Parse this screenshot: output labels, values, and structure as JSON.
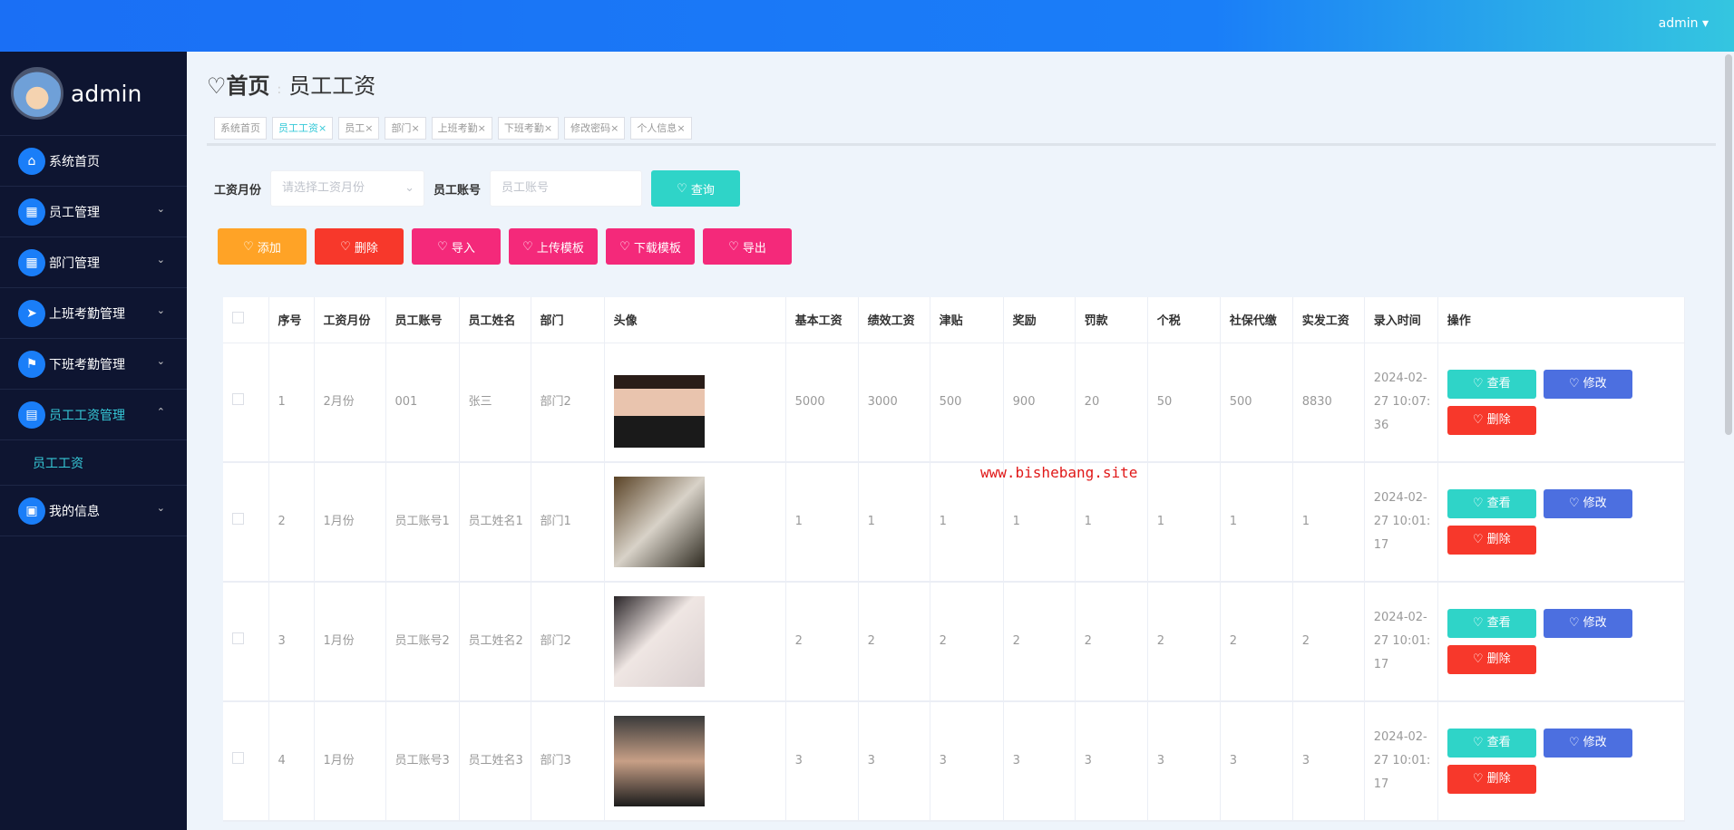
{
  "header": {
    "user": "admin ▾"
  },
  "sidebar": {
    "user": "admin",
    "items": [
      {
        "label": "系统首页",
        "icon": "home-icon",
        "glyph": "⌂",
        "chev": ""
      },
      {
        "label": "员工管理",
        "icon": "grid-icon",
        "glyph": "▦",
        "chev": "⌄"
      },
      {
        "label": "部门管理",
        "icon": "grid-icon",
        "glyph": "▦",
        "chev": "⌄"
      },
      {
        "label": "上班考勤管理",
        "icon": "send-icon",
        "glyph": "➤",
        "chev": "⌄"
      },
      {
        "label": "下班考勤管理",
        "icon": "flag-icon",
        "glyph": "⚑",
        "chev": "⌄"
      },
      {
        "label": "员工工资管理",
        "icon": "chat-icon",
        "glyph": "▤",
        "chev": "⌃",
        "active": true
      },
      {
        "label": "我的信息",
        "icon": "card-icon",
        "glyph": "▣",
        "chev": "⌄"
      }
    ],
    "sub": "员工工资"
  },
  "breadcrumb": {
    "home": "首页",
    "current": "员工工资"
  },
  "tags": [
    "系统首页",
    "员工工资",
    "员工",
    "部门",
    "上班考勤",
    "下班考勤",
    "修改密码",
    "个人信息"
  ],
  "search": {
    "month_label": "工资月份",
    "month_placeholder": "请选择工资月份",
    "account_label": "员工账号",
    "account_placeholder": "员工账号",
    "query": "查询"
  },
  "actions": [
    {
      "label": "添加",
      "color": "#ffa326"
    },
    {
      "label": "删除",
      "color": "#f7382b"
    },
    {
      "label": "导入",
      "color": "#f4297a"
    },
    {
      "label": "上传模板",
      "color": "#f4297a"
    },
    {
      "label": "下载模板",
      "color": "#f4297a"
    },
    {
      "label": "导出",
      "color": "#f4297a"
    }
  ],
  "table": {
    "headers": [
      "",
      "序号",
      "工资月份",
      "员工账号",
      "员工姓名",
      "部门",
      "头像",
      "基本工资",
      "绩效工资",
      "津贴",
      "奖励",
      "罚款",
      "个税",
      "社保代缴",
      "实发工资",
      "录入时间",
      "操作"
    ],
    "rows": [
      [
        "1",
        "2月份",
        "001",
        "张三",
        "部门2",
        "",
        "5000",
        "3000",
        "500",
        "900",
        "20",
        "50",
        "500",
        "8830",
        "2024-02-27 10:07:36"
      ],
      [
        "2",
        "1月份",
        "员工账号1",
        "员工姓名1",
        "部门1",
        "",
        "1",
        "1",
        "1",
        "1",
        "1",
        "1",
        "1",
        "1",
        "2024-02-27 10:01:17"
      ],
      [
        "3",
        "1月份",
        "员工账号2",
        "员工姓名2",
        "部门2",
        "",
        "2",
        "2",
        "2",
        "2",
        "2",
        "2",
        "2",
        "2",
        "2024-02-27 10:01:17"
      ],
      [
        "4",
        "1月份",
        "员工账号3",
        "员工姓名3",
        "部门3",
        "",
        "3",
        "3",
        "3",
        "3",
        "3",
        "3",
        "3",
        "3",
        "2024-02-27 10:01:17"
      ]
    ],
    "ops": {
      "view": "查看",
      "edit": "修改",
      "delete": "删除"
    }
  },
  "watermark": "www.bishebang.site"
}
